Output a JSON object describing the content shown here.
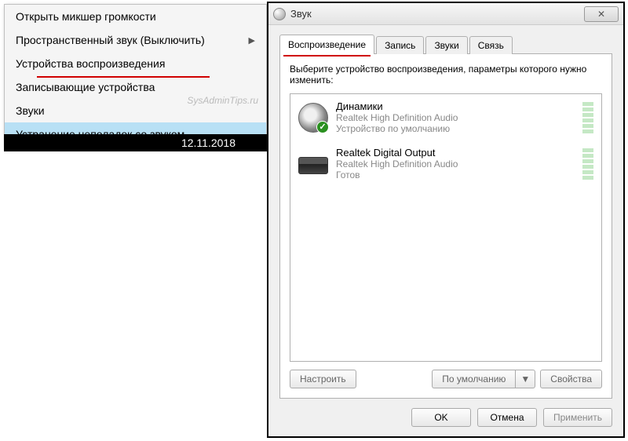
{
  "contextMenu": {
    "items": [
      {
        "label": "Открыть микшер громкости",
        "hasSubmenu": false
      },
      {
        "label": "Пространственный звук (Выключить)",
        "hasSubmenu": true
      },
      {
        "label": "Устройства воспроизведения",
        "hasSubmenu": false
      },
      {
        "label": "Записывающие устройства",
        "hasSubmenu": false
      },
      {
        "label": "Звуки",
        "hasSubmenu": false
      },
      {
        "label": "Устранение неполадок со звуком",
        "hasSubmenu": false
      }
    ],
    "watermark": "SysAdminTips.ru"
  },
  "taskbar": {
    "date": "12.11.2018"
  },
  "soundWindow": {
    "title": "Звук",
    "tabs": [
      {
        "label": "Воспроизведение",
        "active": true
      },
      {
        "label": "Запись",
        "active": false
      },
      {
        "label": "Звуки",
        "active": false
      },
      {
        "label": "Связь",
        "active": false
      }
    ],
    "instruction": "Выберите устройство воспроизведения, параметры которого нужно изменить:",
    "devices": [
      {
        "name": "Динамики",
        "desc": "Realtek High Definition Audio",
        "status": "Устройство по умолчанию",
        "isDefault": true,
        "iconType": "speaker"
      },
      {
        "name": "Realtek Digital Output",
        "desc": "Realtek High Definition Audio",
        "status": "Готов",
        "isDefault": false,
        "iconType": "digital"
      }
    ],
    "buttons": {
      "configure": "Настроить",
      "setDefault": "По умолчанию",
      "properties": "Свойства",
      "ok": "OK",
      "cancel": "Отмена",
      "apply": "Применить"
    }
  }
}
